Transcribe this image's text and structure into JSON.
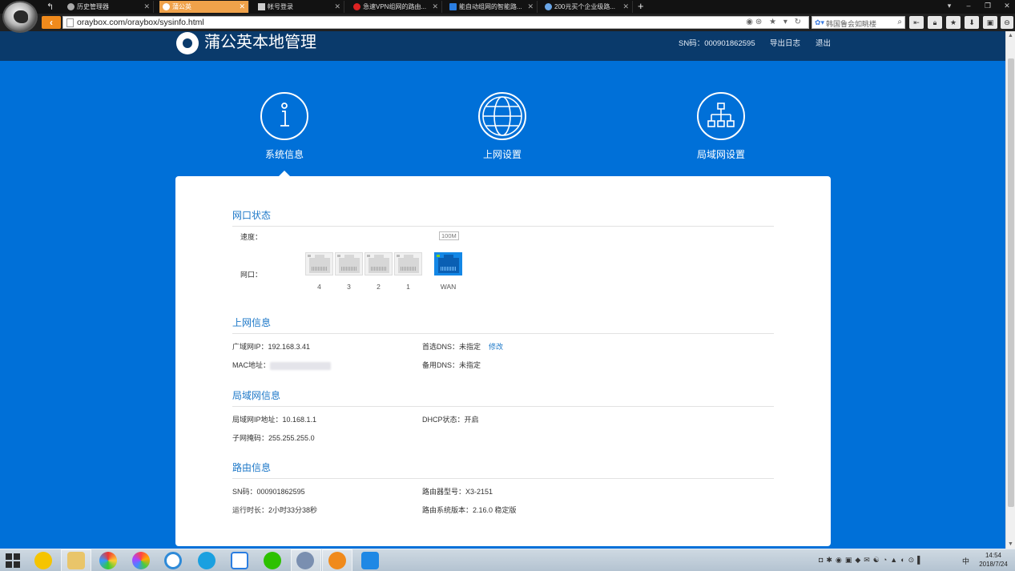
{
  "browser": {
    "tabs": [
      {
        "label": "历史管理器",
        "active": false
      },
      {
        "label": "蒲公英",
        "active": true
      },
      {
        "label": "帐号登录",
        "active": false
      },
      {
        "label": "急速VPN组网的路由...",
        "active": false
      },
      {
        "label": "能自动组网的智能路...",
        "active": false
      },
      {
        "label": "200元买个企业级路...",
        "active": false
      }
    ],
    "new_tab": "+",
    "url": "oraybox.com/oraybox/sysinfo.html",
    "search_placeholder": "韩国鲁会如眺楼"
  },
  "header": {
    "brand": "蒲公英本地管理",
    "sn": "SN码：000901862595",
    "export_log": "导出日志",
    "logout": "退出"
  },
  "nav": [
    {
      "label": "系统信息",
      "icon": "info-icon",
      "active": true
    },
    {
      "label": "上网设置",
      "icon": "globe-icon",
      "active": false
    },
    {
      "label": "局域网设置",
      "icon": "network-icon",
      "active": false
    }
  ],
  "port_status": {
    "title": "网口状态",
    "speed_label": "速度：",
    "speed_value": "100M",
    "ports_label": "网口：",
    "ports": [
      "4",
      "3",
      "2",
      "1"
    ],
    "wan": "WAN"
  },
  "internet_info": {
    "title": "上网信息",
    "wan_ip_label": "广域网IP：",
    "wan_ip": "192.168.3.41",
    "mac_label": "MAC地址：",
    "primary_dns_label": "首选DNS：",
    "primary_dns": "未指定",
    "edit": "修改",
    "secondary_dns_label": "备用DNS：",
    "secondary_dns": "未指定"
  },
  "lan_info": {
    "title": "局域网信息",
    "lan_ip_label": "局域网IP地址：",
    "lan_ip": "10.168.1.1",
    "subnet_label": "子网掩码：",
    "subnet": "255.255.255.0",
    "dhcp_label": "DHCP状态：",
    "dhcp": "开启"
  },
  "router_info": {
    "title": "路由信息",
    "sn_label": "SN码：",
    "sn": "000901862595",
    "uptime_label": "运行时长：",
    "uptime": "2小时33分38秒",
    "model_label": "路由器型号：",
    "model": "X3-2151",
    "version_label": "路由系统版本：",
    "version": "2.16.0 稳定版"
  },
  "taskbar": {
    "ime": "中",
    "time": "14:54",
    "date": "2018/7/24"
  },
  "colors": {
    "page_bg": "#0070d8",
    "header_bg": "#0a3a6b",
    "accent": "#1d78c8",
    "tab_active": "#f0a24a"
  }
}
